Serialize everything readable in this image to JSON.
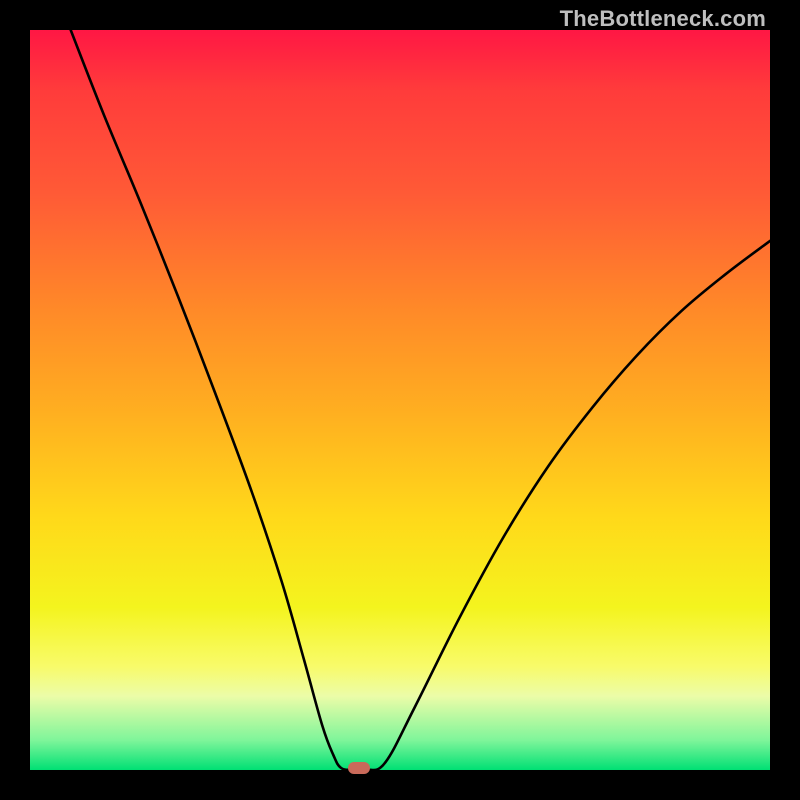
{
  "watermark": "TheBottleneck.com",
  "chart_data": {
    "type": "line",
    "title": "",
    "xlabel": "",
    "ylabel": "",
    "xlim": [
      0,
      1
    ],
    "ylim": [
      0,
      1
    ],
    "grid": false,
    "legend": false,
    "background_gradient": {
      "direction": "top-to-bottom",
      "stops": [
        {
          "pos": 0.0,
          "color": "#ff1744"
        },
        {
          "pos": 0.35,
          "color": "#ff8a28"
        },
        {
          "pos": 0.65,
          "color": "#ffd91a"
        },
        {
          "pos": 0.88,
          "color": "#f8fb6a"
        },
        {
          "pos": 1.0,
          "color": "#00e074"
        }
      ]
    },
    "series": [
      {
        "name": "bottleneck-curve",
        "color": "#000000",
        "x": [
          0.055,
          0.1,
          0.15,
          0.2,
          0.25,
          0.3,
          0.34,
          0.37,
          0.395,
          0.41,
          0.42,
          0.435,
          0.455,
          0.48,
          0.52,
          0.58,
          0.64,
          0.7,
          0.76,
          0.82,
          0.88,
          0.94,
          1.0
        ],
        "y": [
          1.0,
          0.885,
          0.765,
          0.64,
          0.51,
          0.375,
          0.255,
          0.15,
          0.06,
          0.02,
          0.003,
          0.0,
          0.0,
          0.01,
          0.085,
          0.205,
          0.315,
          0.41,
          0.49,
          0.56,
          0.62,
          0.67,
          0.715
        ]
      }
    ],
    "marker": {
      "x": 0.445,
      "y": 0.003,
      "color": "#c96a5a",
      "shape": "rounded-rect"
    }
  }
}
